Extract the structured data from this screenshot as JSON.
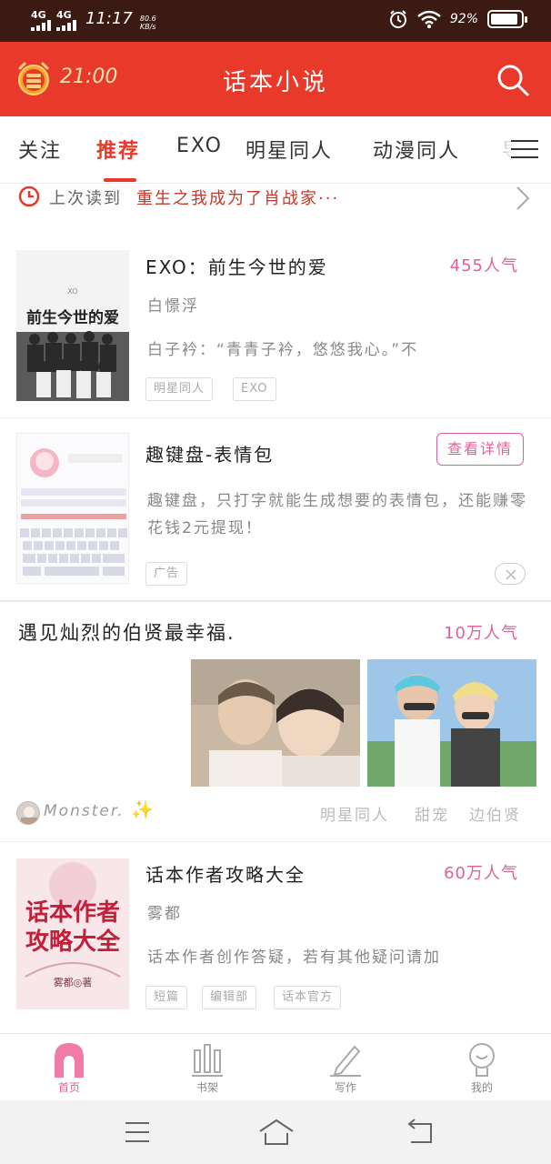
{
  "status_bar": {
    "network1": "4G",
    "network2": "4G",
    "time": "11:17",
    "speed": "80.6",
    "speed_unit": "KB/s",
    "battery": "92%"
  },
  "header": {
    "timer": "21:00",
    "title": "话本小说",
    "alarm_icon": "alarm-clock-icon",
    "search_icon": "search-icon"
  },
  "tabs": [
    "关注",
    "推荐",
    "EXO",
    "明星同人",
    "动漫同人",
    "导"
  ],
  "active_tab": "推荐",
  "last_read": {
    "prefix": "上次读到",
    "book": "重生之我成为了肖战家···"
  },
  "books": [
    {
      "title": "EXO：前生今世的爱",
      "popularity": "455人气",
      "author": "白憬浮",
      "desc": "白子衿：“青青子衿，悠悠我心。”不",
      "tags": [
        "明星同人",
        "EXO"
      ],
      "cover_title": "前生今世的爱"
    }
  ],
  "ad": {
    "title": "趣键盘-表情包",
    "button": "查看详情",
    "desc": "趣键盘，只打字就能生成想要的表情包，还能赚零花钱2元提现！",
    "tag": "广告",
    "close_icon": "close-icon"
  },
  "post": {
    "title": "遇见灿烈的伯贤最幸福.",
    "popularity": "10万人气",
    "username": "Monster.",
    "tags": [
      "明星同人",
      "甜宠",
      "边伯贤"
    ]
  },
  "book2": {
    "title": "话本作者攻略大全",
    "popularity": "60万人气",
    "author": "雾都",
    "desc": "话本作者创作答疑，若有其他疑问请加",
    "tags": [
      "短篇",
      "编辑部",
      "话本官方"
    ],
    "cover_title_line1": "话本作者",
    "cover_title_line2": "攻略大全",
    "cover_author": "雾都◎著"
  },
  "bottom_nav": [
    {
      "label": "首页",
      "icon": "home-icon"
    },
    {
      "label": "书架",
      "icon": "bookshelf-icon"
    },
    {
      "label": "写作",
      "icon": "pencil-icon"
    },
    {
      "label": "我的",
      "icon": "profile-icon"
    }
  ],
  "colors": {
    "brand": "#e8392b",
    "accent_pink": "#e0609a"
  }
}
